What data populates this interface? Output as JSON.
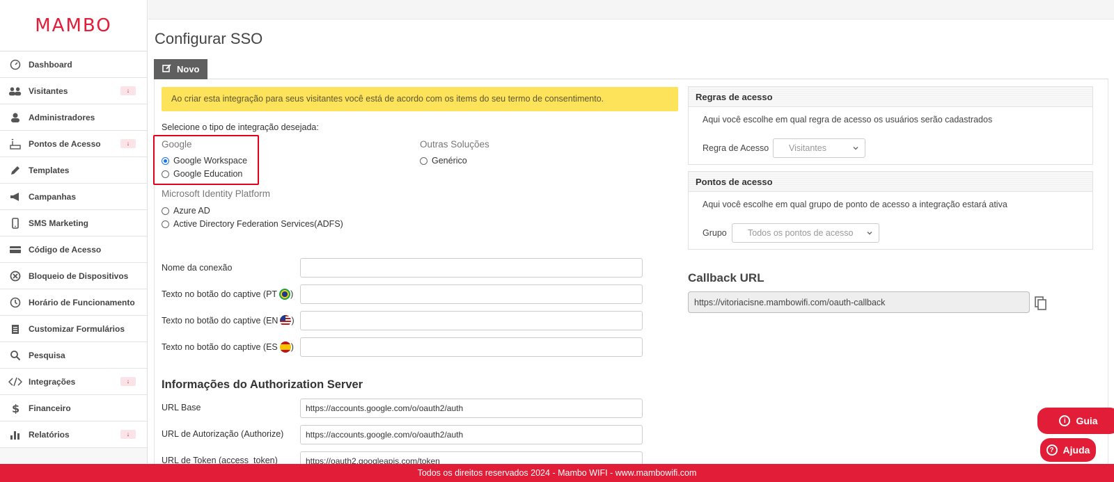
{
  "brand": {
    "logo_text": "MAMBO",
    "accent": "#e11d37"
  },
  "sidebar": {
    "items": [
      {
        "label": "Dashboard",
        "icon": "gauge-icon",
        "badge": ""
      },
      {
        "label": "Visitantes",
        "icon": "users-icon",
        "badge": "↓"
      },
      {
        "label": "Administradores",
        "icon": "user-icon",
        "badge": ""
      },
      {
        "label": "Pontos de Acesso",
        "icon": "router-icon",
        "badge": "↓"
      },
      {
        "label": "Templates",
        "icon": "pencil-icon",
        "badge": ""
      },
      {
        "label": "Campanhas",
        "icon": "megaphone-icon",
        "badge": ""
      },
      {
        "label": "SMS Marketing",
        "icon": "phone-icon",
        "badge": ""
      },
      {
        "label": "Código de Acesso",
        "icon": "card-icon",
        "badge": ""
      },
      {
        "label": "Bloqueio de Dispositivos",
        "icon": "block-icon",
        "badge": ""
      },
      {
        "label": "Horário de Funcionamento",
        "icon": "clock-icon",
        "badge": ""
      },
      {
        "label": "Customizar Formulários",
        "icon": "clipboard-icon",
        "badge": ""
      },
      {
        "label": "Pesquisa",
        "icon": "search-icon",
        "badge": ""
      },
      {
        "label": "Integrações",
        "icon": "code-icon",
        "badge": "↓"
      },
      {
        "label": "Financeiro",
        "icon": "dollar-icon",
        "badge": ""
      },
      {
        "label": "Relatórios",
        "icon": "bar-chart-icon",
        "badge": "↓"
      }
    ]
  },
  "page": {
    "title": "Configurar SSO",
    "tab_new": "Novo"
  },
  "alert": "Ao criar esta integração para seus visitantes você está de acordo com os items do seu termo de consentimento.",
  "integration": {
    "prompt": "Selecione o tipo de integração desejada:",
    "google_title": "Google",
    "google_workspace": "Google Workspace",
    "google_education": "Google Education",
    "microsoft_title": "Microsoft Identity Platform",
    "azure": "Azure AD",
    "adfs": "Active Directory Federation Services(ADFS)",
    "other_title": "Outras Soluções",
    "generic": "Genérico"
  },
  "form": {
    "connection_name_label": "Nome da conexão",
    "connection_name_value": "",
    "captive_pt_label": "Texto no botão do captive (PT",
    "captive_en_label": "Texto no botão do captive (EN",
    "captive_es_label": "Texto no botão do captive (ES",
    "captive_close": ")",
    "captive_pt_value": "",
    "captive_en_value": "",
    "captive_es_value": ""
  },
  "auth_server": {
    "title": "Informações do Authorization Server",
    "url_base_label": "URL Base",
    "url_base_value": "https://accounts.google.com/o/oauth2/auth",
    "authorize_label": "URL de Autorização (Authorize)",
    "authorize_value": "https://accounts.google.com/o/oauth2/auth",
    "token_label": "URL de Token (access_token)",
    "token_value": "https://oauth2.googleapis.com/token"
  },
  "access_rules": {
    "title": "Regras de acesso",
    "description": "Aqui você escolhe em qual regra de acesso os usuários serão cadastrados",
    "field_label": "Regra de Acesso",
    "selected": "Visitantes"
  },
  "access_points": {
    "title": "Pontos de acesso",
    "description": "Aqui você escolhe em qual grupo de ponto de acesso a integração estará ativa",
    "field_label": "Grupo",
    "selected": "Todos os pontos de acesso"
  },
  "callback": {
    "title": "Callback URL",
    "value": "https://vitoriacisne.mambowifi.com/oauth-callback"
  },
  "help": {
    "guide": "Guia",
    "help": "Ajuda"
  },
  "footer": "Todos os direitos reservados 2024 - Mambo WIFI - www.mambowifi.com"
}
